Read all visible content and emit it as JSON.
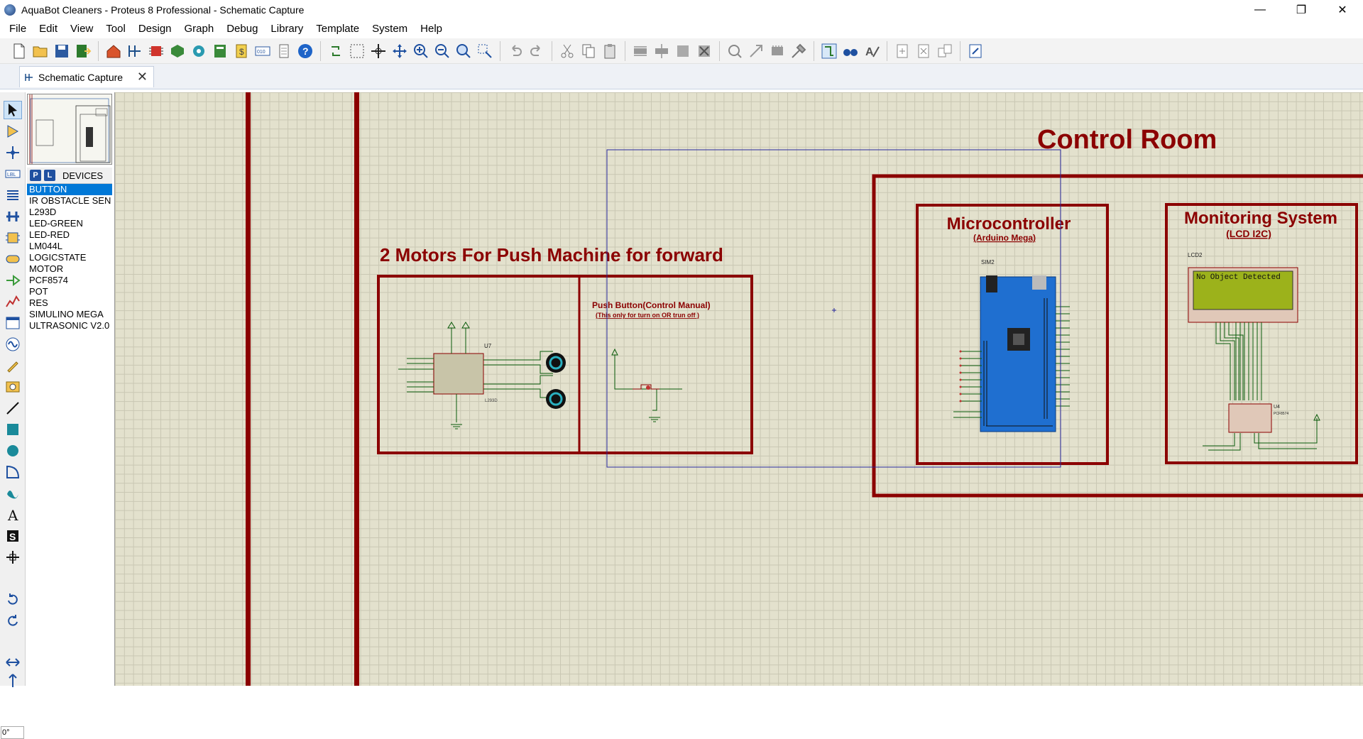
{
  "window": {
    "title": "AquaBot Cleaners - Proteus 8 Professional - Schematic Capture",
    "minimize": "—",
    "maximize": "❐",
    "close": "✕"
  },
  "menu": [
    "File",
    "Edit",
    "View",
    "Tool",
    "Design",
    "Graph",
    "Debug",
    "Library",
    "Template",
    "System",
    "Help"
  ],
  "tab": {
    "label": "Schematic Capture",
    "close": "✕"
  },
  "device_panel": {
    "p_button": "P",
    "l_button": "L",
    "header": "DEVICES",
    "items": [
      "BUTTON",
      "IR OBSTACLE SEN",
      "L293D",
      "LED-GREEN",
      "LED-RED",
      "LM044L",
      "LOGICSTATE",
      "MOTOR",
      "PCF8574",
      "POT",
      "RES",
      "SIMULINO MEGA",
      "ULTRASONIC V2.0"
    ],
    "selected": "BUTTON"
  },
  "rotation": "0°",
  "schematic": {
    "control_room": "Control Room",
    "microcontroller": "Microcontroller",
    "arduino_mega": "(Arduino Mega)",
    "monitoring": "Monitoring System",
    "lcd_i2c": "(LCD I2C)",
    "motors": "2 Motors For Push Machine for forward",
    "push_button": "Push Button(Control Manual)",
    "push_note": "(This only for turn on OR  trun off )",
    "lcd_ref": "LCD2",
    "lcd_text": "No Object Detected",
    "sim_ref": "SIM2",
    "u7_ref": "U7",
    "u4_ref": "U4",
    "l293d": "L293D",
    "pcf": "PCF8574"
  },
  "colors": {
    "accent": "#8b0000",
    "canvas": "#e3e1cd",
    "wire": "#0a5a0a",
    "arduino": "#1f6fd0",
    "lcd": "#9cb21b",
    "selection": "#2a2aa0",
    "list_selected": "#0078d7"
  }
}
